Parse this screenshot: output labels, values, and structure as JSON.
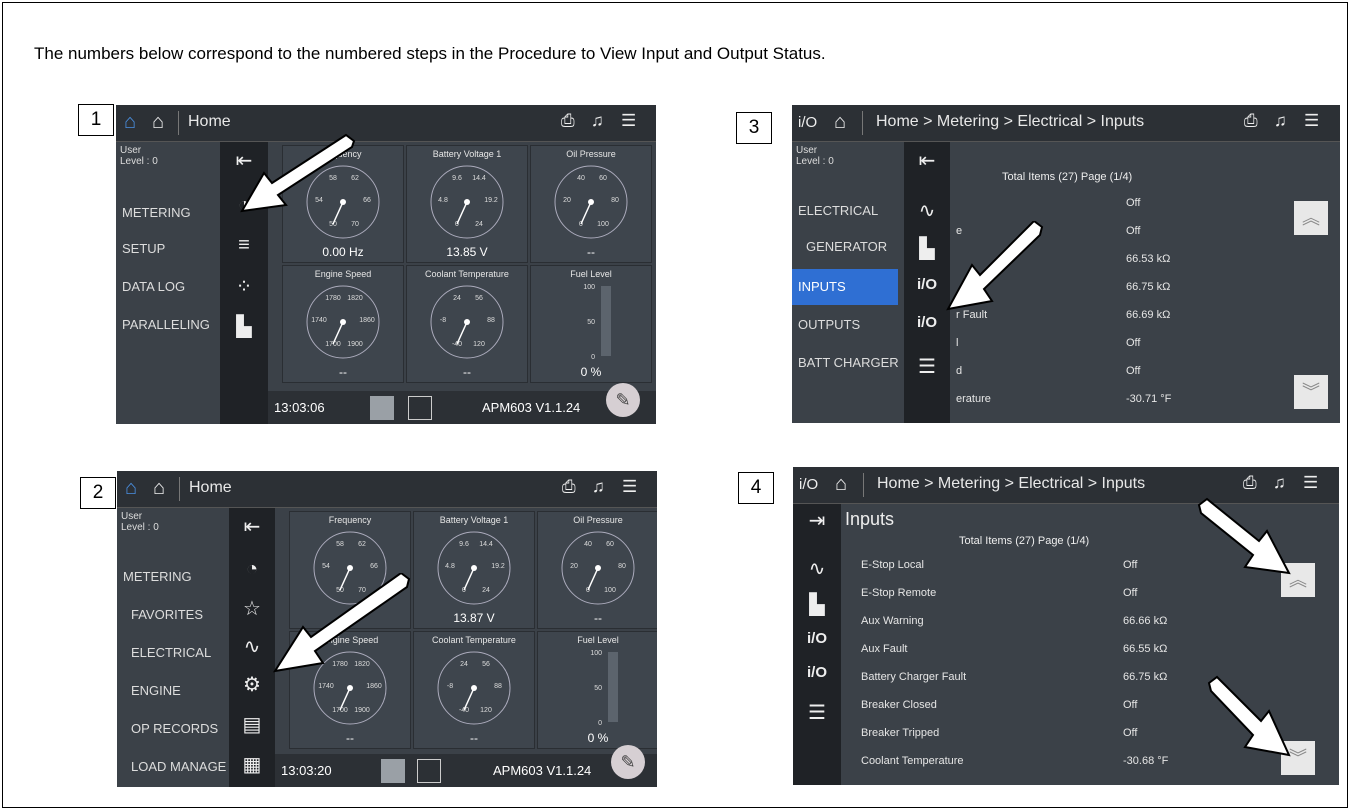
{
  "intro": "The numbers below correspond to the numbered steps in the Procedure to View Input and Output Status.",
  "steps": [
    "1",
    "2",
    "3",
    "4"
  ],
  "common": {
    "home": "Home",
    "user": "User",
    "level": "Level : 0",
    "version": "APM603 V1.1.24",
    "breadcrumb": "Home > Metering > Electrical > Inputs",
    "io_icon": "i/O",
    "total": "Total Items (27) Page (1/4)"
  },
  "shot1": {
    "menu": [
      "METERING",
      "SETUP",
      "DATA LOG",
      "PARALLELING"
    ],
    "time": "13:03:06",
    "gauges": [
      {
        "title": "Frequency",
        "title_visible": "requency",
        "ticks": [
          "58",
          "62",
          "54",
          "66",
          "50",
          "70"
        ],
        "value": "0.00 Hz"
      },
      {
        "title": "Battery Voltage 1",
        "ticks": [
          "9.6",
          "14.4",
          "4.8",
          "19.2",
          "0",
          "24"
        ],
        "value": "13.85 V"
      },
      {
        "title": "Oil Pressure",
        "ticks": [
          "40",
          "60",
          "20",
          "80",
          "0",
          "100"
        ],
        "value": "--"
      },
      {
        "title": "Engine Speed",
        "ticks": [
          "1780",
          "1820",
          "1740",
          "1860",
          "1700",
          "1900"
        ],
        "value": "--"
      },
      {
        "title": "Coolant Temperature",
        "ticks": [
          "24",
          "56",
          "-8",
          "88",
          "-40",
          "120"
        ],
        "value": "--"
      },
      {
        "title": "Fuel Level",
        "ticks": [
          "100",
          "50",
          "0"
        ],
        "value": "0 %"
      }
    ]
  },
  "shot2": {
    "menu": [
      "METERING",
      "FAVORITES",
      "ELECTRICAL",
      "ENGINE",
      "OP RECORDS",
      "LOAD MANAGE"
    ],
    "time": "13:03:20",
    "gauges": [
      {
        "title": "Frequency",
        "ticks": [
          "58",
          "62",
          "54",
          "66",
          "50",
          "70"
        ],
        "value": "Hz"
      },
      {
        "title": "Battery Voltage 1",
        "ticks": [
          "9.6",
          "14.4",
          "4.8",
          "19.2",
          "0",
          "24"
        ],
        "value": "13.87 V"
      },
      {
        "title": "Oil Pressure",
        "ticks": [
          "40",
          "60",
          "20",
          "80",
          "0",
          "100"
        ],
        "value": "--"
      },
      {
        "title": "Engine Speed",
        "ticks": [
          "1780",
          "1820",
          "1740",
          "1860",
          "1700",
          "1900"
        ],
        "value": "--"
      },
      {
        "title": "Coolant Temperature",
        "ticks": [
          "24",
          "56",
          "-8",
          "88",
          "-40",
          "120"
        ],
        "value": "--"
      },
      {
        "title": "Fuel Level",
        "ticks": [
          "100",
          "50",
          "0"
        ],
        "value": "0 %"
      }
    ]
  },
  "shot3": {
    "menu": [
      "ELECTRICAL",
      "GENERATOR",
      "INPUTS",
      "OUTPUTS",
      "BATT CHARGER"
    ],
    "rows": [
      {
        "name": "",
        "value": "Off"
      },
      {
        "name": "e",
        "value": "Off"
      },
      {
        "name": "",
        "value": "66.53 kΩ"
      },
      {
        "name": "",
        "value": "66.75 kΩ"
      },
      {
        "name": "r Fault",
        "value": "66.69 kΩ"
      },
      {
        "name": "l",
        "value": "Off"
      },
      {
        "name": "d",
        "value": "Off"
      },
      {
        "name": "erature",
        "value": "-30.71 °F"
      }
    ]
  },
  "shot4": {
    "title": "Inputs",
    "rows": [
      {
        "name": "E-Stop Local",
        "value": "Off"
      },
      {
        "name": "E-Stop Remote",
        "value": "Off"
      },
      {
        "name": "Aux Warning",
        "value": "66.66 kΩ"
      },
      {
        "name": "Aux Fault",
        "value": "66.55 kΩ"
      },
      {
        "name": "Battery Charger Fault",
        "value": "66.75 kΩ"
      },
      {
        "name": "Breaker Closed",
        "value": "Off"
      },
      {
        "name": "Breaker Tripped",
        "value": "Off"
      },
      {
        "name": "Coolant Temperature",
        "value": "-30.68 °F"
      }
    ]
  }
}
